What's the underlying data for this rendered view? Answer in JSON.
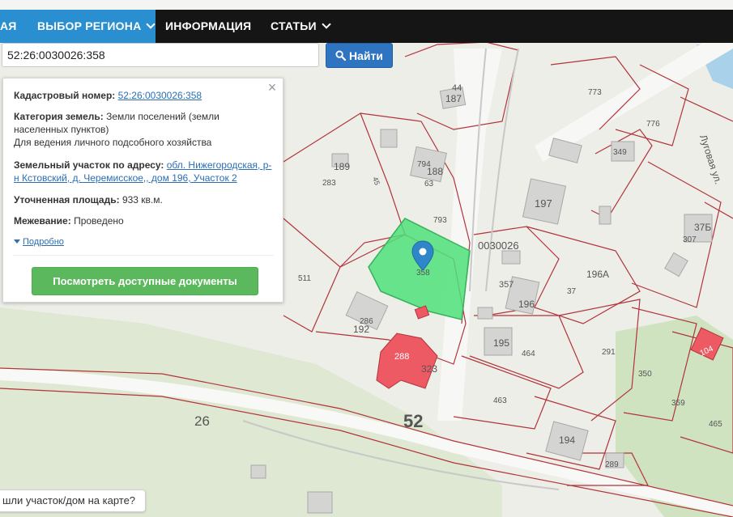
{
  "nav": {
    "home_label": "АЯ",
    "region_label": "ВЫБОР РЕГИОНА",
    "info_label": "ИНФОРМАЦИЯ",
    "articles_label": "СТАТЬИ"
  },
  "search": {
    "value": "52:26:0030026:358",
    "button_label": "Найти"
  },
  "panel": {
    "cadastral_label": "Кадастровый номер:",
    "cadastral_value": "52:26:0030026:358",
    "category_label": "Категория земель:",
    "category_value_1": "Земли поселений (земли",
    "category_value_2": "населенных пунктов)",
    "category_value_3": "Для ведения личного подсобного хозяйства",
    "address_label": "Земельный участок по адресу:",
    "address_value_1": "обл. Нижегородская, р-",
    "address_value_2": "н Кстовский, д. Черемисское,, дом 196, Участок 2",
    "area_label": "Уточненная площадь:",
    "area_value": "933 кв.м.",
    "survey_label": "Межевание:",
    "survey_value": "Проведено",
    "details_link": "Подробно",
    "docs_button": "Посмотреть доступные документы"
  },
  "map": {
    "street_label": "Луговая ул.",
    "quarter_label": "0030026",
    "road_number": "52",
    "parcel_labels": [
      "44",
      "187",
      "773",
      "776",
      "349",
      "189",
      "283",
      "45",
      "794",
      "188",
      "63",
      "197",
      "793",
      "37Б",
      "307",
      "511",
      "358",
      "357",
      "196",
      "37",
      "196А",
      "192",
      "286",
      "195",
      "464",
      "291",
      "350",
      "288",
      "323",
      "463",
      "359",
      "465",
      "194",
      "289",
      "26",
      "104"
    ]
  },
  "bottom_prompt": "шли участок/дом на карте?"
}
